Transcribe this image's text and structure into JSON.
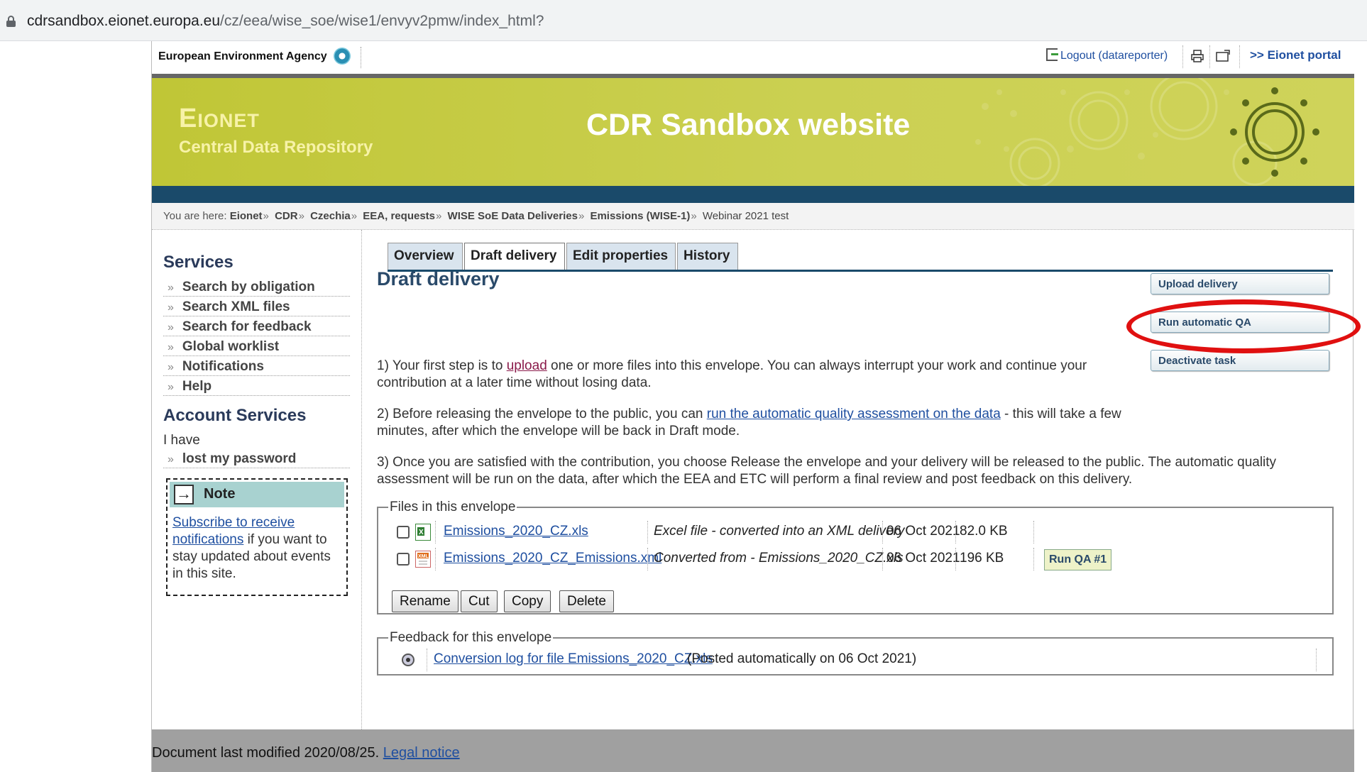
{
  "browser": {
    "url_host": "cdrsandbox.eionet.europa.eu",
    "url_path": "/cz/eea/wise_soe/wise1/envyv2pmw/index_html?"
  },
  "topbar": {
    "agency": "European Environment Agency",
    "logout": "Logout (datareporter)",
    "portal": ">> Eionet portal"
  },
  "header": {
    "site": "Eionet",
    "subtitle": "Central Data Repository",
    "title": "CDR Sandbox website"
  },
  "breadcrumb": {
    "prefix": "You are here:",
    "items": [
      "Eionet",
      "CDR",
      "Czechia",
      "EEA, requests",
      "WISE SoE Data Deliveries",
      "Emissions (WISE-1)",
      "Webinar 2021 test"
    ],
    "separator": "»"
  },
  "sidebar": {
    "services_title": "Services",
    "services": [
      "Search by obligation",
      "Search XML files",
      "Search for feedback",
      "Global worklist",
      "Notifications",
      "Help"
    ],
    "account_title": "Account Services",
    "account_intro": "I have",
    "account_items": [
      "lost my password"
    ],
    "bullet": "»",
    "note": {
      "title": "Note",
      "link": "Subscribe to receive notifications",
      "text": " if you want to stay updated about events in this site."
    }
  },
  "tabs": [
    "Overview",
    "Draft delivery",
    "Edit properties",
    "History"
  ],
  "main": {
    "heading": "Draft delivery",
    "step1_a": "1) Your first step is to ",
    "step1_link": "upload",
    "step1_b": " one or more files into this envelope. You can always interrupt your work and continue your contribution at a later time without losing data.",
    "step2_a": "2) Before releasing the envelope to the public, you can ",
    "step2_link": "run the automatic quality assessment on the data",
    "step2_b": " - this will take a few minutes, after which the envelope will be back in Draft mode.",
    "step3": "3) Once you are satisfied with the contribution, you choose Release the envelope and your delivery will be released to the public. The automatic quality assessment will be run on the data, after which the EEA and ETC will perform a final review and post feedback on this delivery.",
    "actions": [
      "Upload delivery",
      "Run automatic QA",
      "Deactivate task"
    ]
  },
  "files": {
    "legend": "Files in this envelope",
    "rows": [
      {
        "name": "Emissions_2020_CZ.xls",
        "desc": "Excel file - converted into an XML delivery",
        "date": "06 Oct 2021",
        "size": "82.0 KB",
        "qa": ""
      },
      {
        "name": "Emissions_2020_CZ_Emissions.xml",
        "desc": "Converted from - Emissions_2020_CZ.xls",
        "date": "06 Oct 2021",
        "size": "196 KB",
        "qa": "Run QA #1"
      }
    ],
    "buttons": [
      "Rename",
      "Cut",
      "Copy",
      "Delete"
    ]
  },
  "feedback": {
    "legend": "Feedback for this envelope",
    "link": "Conversion log for file Emissions_2020_CZ.xls",
    "posted": " (Posted automatically on 06 Oct 2021)"
  },
  "footer": {
    "text": "Document last modified 2020/08/25. ",
    "link": "Legal notice"
  },
  "colors": {
    "banner": "#c0c636",
    "navbar": "#1a4a6a",
    "highlight_oval": "#e01010"
  }
}
